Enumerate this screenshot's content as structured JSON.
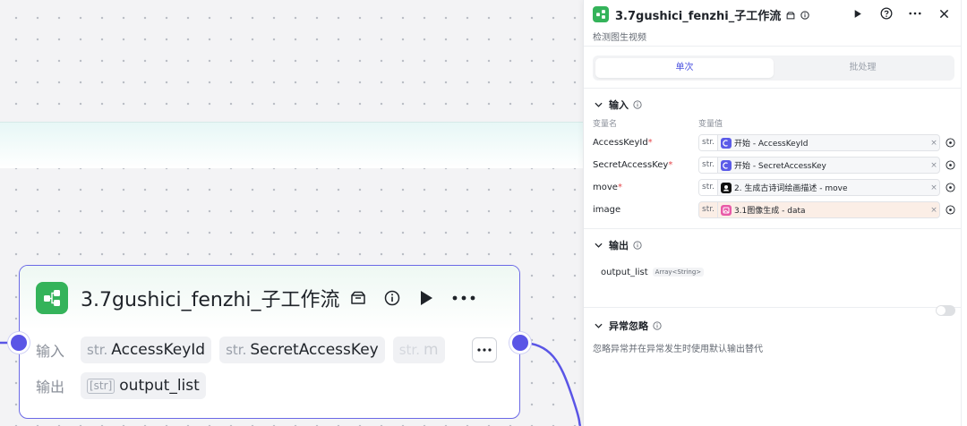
{
  "node": {
    "title": "3.7gushici_fenzhi_子工作流",
    "input_label": "输入",
    "output_label": "输出",
    "inputs": [
      {
        "type": "str.",
        "name": "AccessKeyId"
      },
      {
        "type": "str.",
        "name": "SecretAccessKey"
      },
      {
        "type": "str.",
        "name": "m"
      }
    ],
    "output": {
      "type": "[str]",
      "name": "output_list"
    }
  },
  "panel": {
    "title": "3.7gushici_fenzhi_子工作流",
    "description": "检测图生视频",
    "tabs": [
      {
        "label": "单次",
        "active": true
      },
      {
        "label": "批处理",
        "active": false
      }
    ],
    "input_section": {
      "title": "输入",
      "col_name": "变量名",
      "col_value": "变量值",
      "rows": [
        {
          "name": "AccessKeyId",
          "required": true,
          "type": "str.",
          "source_icon": "start-icon",
          "ref": "开始 - AccessKeyId"
        },
        {
          "name": "SecretAccessKey",
          "required": true,
          "type": "str.",
          "source_icon": "start-icon",
          "ref": "开始 - SecretAccessKey"
        },
        {
          "name": "move",
          "required": true,
          "type": "str.",
          "source_icon": "llm-icon",
          "ref": "2. 生成古诗词绘画描述 - move"
        },
        {
          "name": "image",
          "required": false,
          "type": "str.",
          "source_icon": "image-gen-icon",
          "ref": "3.1图像生成 - data"
        }
      ],
      "clear_symbol": "×",
      "required_mark": "*"
    },
    "output_section": {
      "title": "输出",
      "name": "output_list",
      "type": "Array<String>"
    },
    "exception_section": {
      "title": "异常忽略",
      "description": "忽略异常并在异常发生时使用默认输出替代",
      "enabled": false
    }
  },
  "colors": {
    "accent": "#5a55e6",
    "node_logo": "#34b35a",
    "start_icon": "#5b5be8",
    "image_icon": "#e85aa8",
    "required": "#e5484d"
  }
}
